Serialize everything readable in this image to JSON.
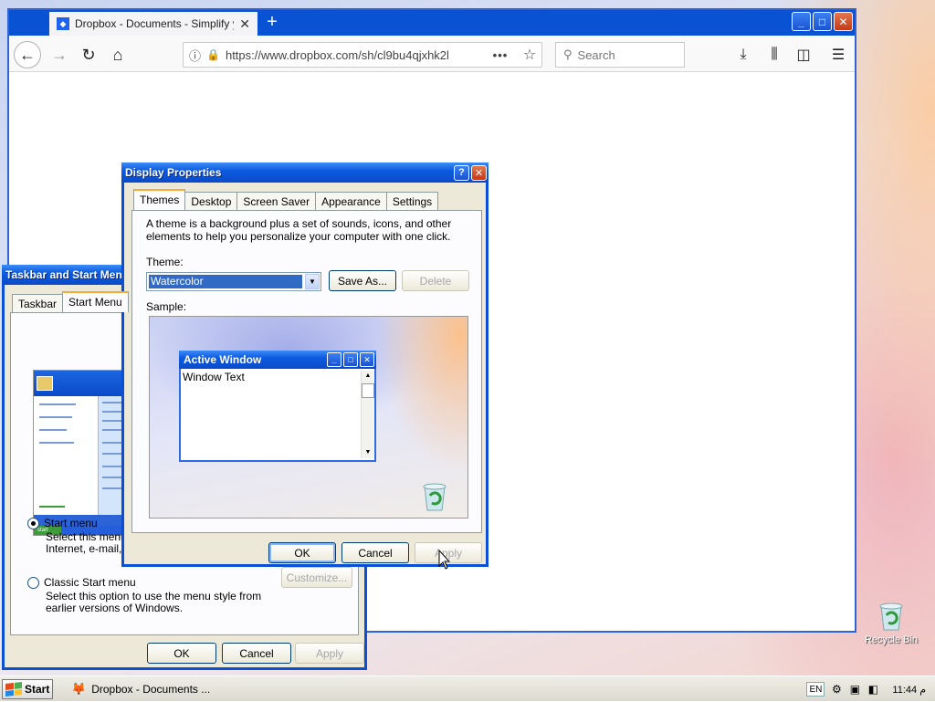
{
  "browser": {
    "tab_title": "Dropbox - Documents - Simplify yo",
    "new_tab_label": "+",
    "url": "https://www.dropbox.com/sh/cl9bu4qjxhk2l",
    "search_placeholder": "Search",
    "window_buttons": [
      "_",
      "□",
      "✕"
    ]
  },
  "display_properties": {
    "title": "Display Properties",
    "tabs": [
      "Themes",
      "Desktop",
      "Screen Saver",
      "Appearance",
      "Settings"
    ],
    "active_tab": "Themes",
    "description": "A theme is a background plus a set of sounds, icons, and other elements to help you personalize your computer with one click.",
    "theme_label": "Theme:",
    "theme_value": "Watercolor",
    "save_as_label": "Save As...",
    "delete_label": "Delete",
    "sample_label": "Sample:",
    "sample_window_title": "Active Window",
    "sample_window_text": "Window Text",
    "ok_label": "OK",
    "cancel_label": "Cancel",
    "apply_label": "Apply"
  },
  "taskbar_startmenu": {
    "title": "Taskbar and Start Menu",
    "tabs": [
      "Taskbar",
      "Start Menu"
    ],
    "active_tab": "Start Menu",
    "option_start_menu": "Start menu",
    "option_start_menu_desc": "Select this menu st\nInternet, e-mail, an",
    "option_classic": "Classic Start menu",
    "option_classic_desc": "Select this option to use the menu style from\nearlier versions of Windows.",
    "customize_label": "Customize...",
    "ok_label": "OK",
    "cancel_label": "Cancel",
    "apply_label": "Apply",
    "selected_option": "Start menu"
  },
  "taskbar": {
    "start_label": "Start",
    "task_item": "Dropbox - Documents ...",
    "language": "EN",
    "clock": "11:44 م"
  },
  "desktop": {
    "recycle_bin_label": "Recycle Bin"
  },
  "colors": {
    "xp_title_blue": "#0a4fd4",
    "dialog_face": "#ece9d8",
    "selection": "#316ac5"
  }
}
